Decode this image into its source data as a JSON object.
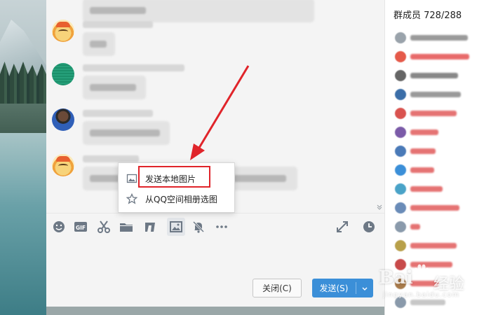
{
  "popup_menu": {
    "items": [
      {
        "label": "发送本地图片",
        "icon": "image-icon"
      },
      {
        "label": "从QQ空间相册选图",
        "icon": "star-icon"
      }
    ],
    "highlight_color": "#e0242a"
  },
  "members_panel": {
    "title": "群成员 728/288"
  },
  "footer": {
    "close_label": "关闭(C)",
    "send_label": "发送(S)",
    "send_dropdown_icon": "chevron-down-icon"
  },
  "toolbar": {
    "icons": [
      "emoji-icon",
      "gif-icon",
      "scissors-icon",
      "folder-icon",
      "music-note-icon",
      "image-icon",
      "bell-off-icon",
      "more-icon",
      "expand-icon",
      "clock-icon"
    ]
  },
  "watermark": {
    "brand": "Bai",
    "cn": "经验",
    "url": "jingyan.baidu.com"
  },
  "colors": {
    "accent_blue": "#3b8fd8",
    "annotation_red": "#e0242a",
    "window_bg": "#f4f4f4"
  }
}
